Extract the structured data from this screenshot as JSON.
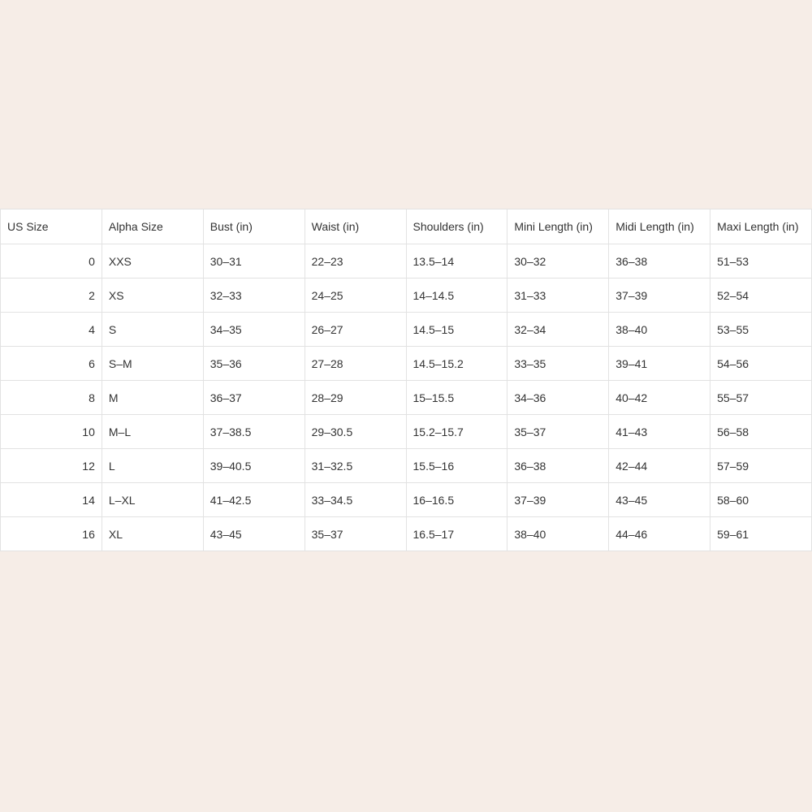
{
  "size_chart": {
    "headers": [
      "US Size",
      "Alpha Size",
      "Bust (in)",
      "Waist (in)",
      "Shoulders (in)",
      "Mini Length (in)",
      "Midi Length (in)",
      "Maxi Length (in)"
    ],
    "rows": [
      [
        "0",
        "XXS",
        "30–31",
        "22–23",
        "13.5–14",
        "30–32",
        "36–38",
        "51–53"
      ],
      [
        "2",
        "XS",
        "32–33",
        "24–25",
        "14–14.5",
        "31–33",
        "37–39",
        "52–54"
      ],
      [
        "4",
        "S",
        "34–35",
        "26–27",
        "14.5–15",
        "32–34",
        "38–40",
        "53–55"
      ],
      [
        "6",
        "S–M",
        "35–36",
        "27–28",
        "14.5–15.2",
        "33–35",
        "39–41",
        "54–56"
      ],
      [
        "8",
        "M",
        "36–37",
        "28–29",
        "15–15.5",
        "34–36",
        "40–42",
        "55–57"
      ],
      [
        "10",
        "M–L",
        "37–38.5",
        "29–30.5",
        "15.2–15.7",
        "35–37",
        "41–43",
        "56–58"
      ],
      [
        "12",
        "L",
        "39–40.5",
        "31–32.5",
        "15.5–16",
        "36–38",
        "42–44",
        "57–59"
      ],
      [
        "14",
        "L–XL",
        "41–42.5",
        "33–34.5",
        "16–16.5",
        "37–39",
        "43–45",
        "58–60"
      ],
      [
        "16",
        "XL",
        "43–45",
        "35–37",
        "16.5–17",
        "38–40",
        "44–46",
        "59–61"
      ]
    ]
  }
}
